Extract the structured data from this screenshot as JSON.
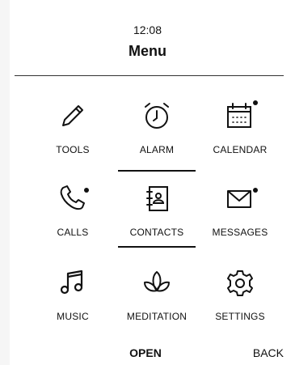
{
  "status": {
    "time": "12:08"
  },
  "header": {
    "title": "Menu"
  },
  "menu": {
    "items": [
      {
        "label": "TOOLS",
        "icon": "pencil-icon",
        "badge": false
      },
      {
        "label": "ALARM",
        "icon": "alarm-clock-icon",
        "badge": false
      },
      {
        "label": "CALENDAR",
        "icon": "calendar-icon",
        "badge": true
      },
      {
        "label": "CALLS",
        "icon": "phone-icon",
        "badge": true
      },
      {
        "label": "CONTACTS",
        "icon": "contacts-book-icon",
        "badge": false,
        "selected": true
      },
      {
        "label": "MESSAGES",
        "icon": "envelope-icon",
        "badge": true
      },
      {
        "label": "MUSIC",
        "icon": "music-note-icon",
        "badge": false
      },
      {
        "label": "MEDITATION",
        "icon": "lotus-icon",
        "badge": false
      },
      {
        "label": "SETTINGS",
        "icon": "gear-icon",
        "badge": false
      }
    ]
  },
  "softkeys": {
    "center": "OPEN",
    "right": "BACK"
  },
  "colors": {
    "foreground": "#111111",
    "background": "#ffffff"
  }
}
